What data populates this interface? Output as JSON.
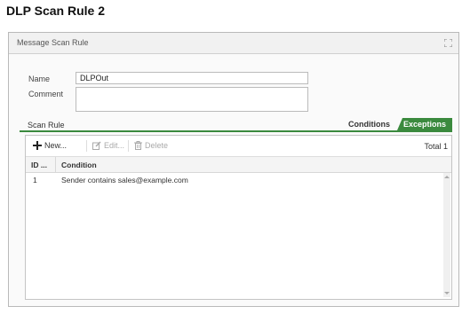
{
  "page": {
    "title": "DLP Scan Rule 2"
  },
  "dialog": {
    "title": "Message Scan Rule"
  },
  "form": {
    "name_label": "Name",
    "name_value": "DLPOut",
    "comment_label": "Comment",
    "comment_value": ""
  },
  "scan_rule": {
    "section_label": "Scan Rule",
    "tabs": [
      {
        "label": "Conditions",
        "active": false
      },
      {
        "label": "Exceptions",
        "active": true
      }
    ]
  },
  "toolbar": {
    "new_label": "New...",
    "edit_label": "Edit...",
    "delete_label": "Delete",
    "total_label": "Total 1"
  },
  "table": {
    "columns": [
      "ID ...",
      "Condition"
    ],
    "rows": [
      {
        "id": "1",
        "condition": "Sender contains sales@example.com"
      }
    ]
  },
  "colors": {
    "accent": "#3b8a3e"
  }
}
